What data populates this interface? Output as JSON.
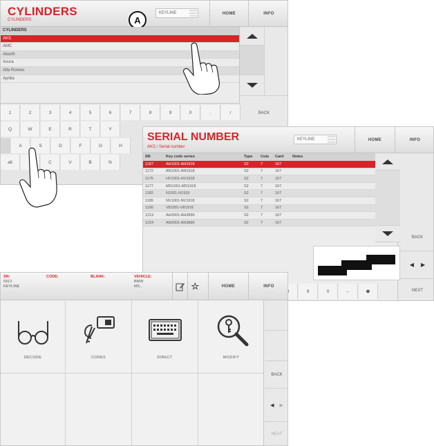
{
  "screen1": {
    "title": "CYLINDERS",
    "subtitle": "CYLINDERS",
    "callout": "A",
    "selector_value": "KEYLINE",
    "home_label": "HOME",
    "info_label": "INFO",
    "list_header": "CYLINDERS",
    "list_items": [
      "AKS",
      "AMC",
      "Abarth",
      "Acura",
      "Alfa Romeo",
      "Aprilia"
    ],
    "back_label": "BACK",
    "keyboard_row1": [
      "1",
      "2",
      "3",
      "4",
      "5",
      "6",
      "7",
      "8",
      "9",
      "0",
      ".",
      "/"
    ],
    "keyboard_row2": [
      "Q",
      "W",
      "E",
      "R",
      "T",
      "Y"
    ],
    "keyboard_row3": [
      "A",
      "S",
      "D",
      "F",
      "G",
      "H"
    ],
    "keyboard_row4": [
      "alt",
      "C",
      "V",
      "B",
      "N"
    ]
  },
  "screen2": {
    "title": "SERIAL NUMBER",
    "subtitle": "AKS / Serial number",
    "selector_value": "KEYLINE",
    "home_label": "HOME",
    "info_label": "INFO",
    "columns": [
      "SN",
      "Key code series",
      "Type",
      "Cuts",
      "Card",
      "Notes"
    ],
    "rows": [
      [
        "1167",
        "AH1001-AH1918",
        "S2",
        "7",
        "167",
        ""
      ],
      [
        "1172",
        "AN1001-AN1918",
        "S2",
        "7",
        "167",
        ""
      ],
      [
        "1176",
        "HV1001-HV1918",
        "S2",
        "7",
        "167",
        ""
      ],
      [
        "1177",
        "MD1001-MD1918",
        "S2",
        "7",
        "167",
        ""
      ],
      [
        "1182",
        "N1001-N1918",
        "S2",
        "7",
        "167",
        ""
      ],
      [
        "1185",
        "NV1001-NV1918",
        "S2",
        "7",
        "167",
        ""
      ],
      [
        "1190",
        "V81001-V81918",
        "S2",
        "7",
        "167",
        ""
      ],
      [
        "1219",
        "AH3001-AH3890",
        "S2",
        "7",
        "167",
        ""
      ],
      [
        "1224",
        "AN3001-AN3890",
        "S2",
        "7",
        "167",
        ""
      ]
    ],
    "back_label": "BACK",
    "next_label": "NEXT",
    "keyboard_keys": [
      "8",
      "9",
      "0",
      "←",
      "⊗"
    ]
  },
  "screen3": {
    "sn_label": "SN:",
    "sn_value_1": "5912",
    "sn_value_2": "KEYLINE",
    "code_label": "CODE:",
    "blank_label": "BLANK:",
    "vehicle_label": "VEHICLE:",
    "vehicle_value_1": "BMW",
    "vehicle_value_2": "M3...",
    "home_label": "HOME",
    "info_label": "INFO",
    "tiles": [
      {
        "label": "DECODE",
        "icon": "glasses-icon"
      },
      {
        "label": "CODES",
        "icon": "key-code-icon"
      },
      {
        "label": "DIRECT",
        "icon": "keyboard-icon"
      },
      {
        "label": "MODIFY",
        "icon": "magnifier-key-icon"
      }
    ],
    "back_label": "BACK",
    "next_label": "NEXT"
  },
  "colors": {
    "accent": "#d8232a",
    "panel": "#ececec",
    "header": "#e2e2e2"
  }
}
